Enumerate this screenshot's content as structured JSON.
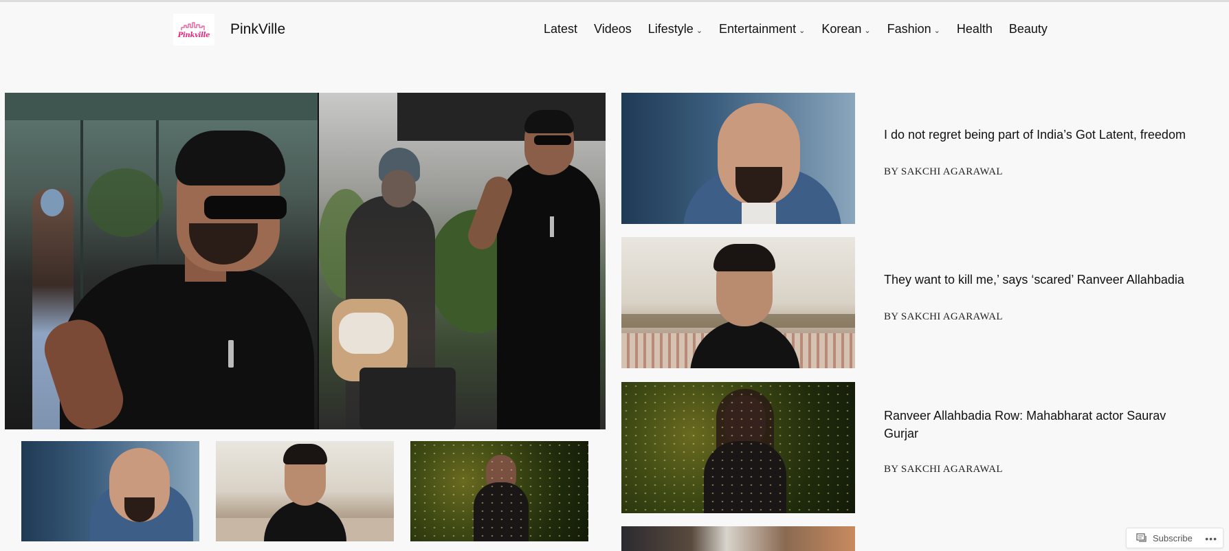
{
  "site": {
    "logo_text": "Pinkville",
    "title": "PinkVille"
  },
  "nav": {
    "items": [
      {
        "label": "Latest",
        "has_dropdown": false
      },
      {
        "label": "Videos",
        "has_dropdown": false
      },
      {
        "label": "Lifestyle",
        "has_dropdown": true
      },
      {
        "label": "Entertainment",
        "has_dropdown": true
      },
      {
        "label": "Korean",
        "has_dropdown": true
      },
      {
        "label": "Fashion",
        "has_dropdown": true
      },
      {
        "label": "Health",
        "has_dropdown": false
      },
      {
        "label": "Beauty",
        "has_dropdown": false
      }
    ],
    "dropdown_glyph": "⌄"
  },
  "articles": [
    {
      "title": "I do not regret being part of India’s Got Latent, freedom",
      "byline": "BY SAKCHI AGARAWAL"
    },
    {
      "title": "They want to kill me,’ says ‘scared’ Ranveer Allahbadia",
      "byline": "BY SAKCHI AGARAWAL"
    },
    {
      "title": "Ranveer Allahbadia Row: Mahabharat actor Saurav Gurjar",
      "byline": "BY SAKCHI AGARAWAL"
    }
  ],
  "subscribe": {
    "label": "Subscribe",
    "more": "•••"
  },
  "colors": {
    "background": "#f8f8f8",
    "brand_pink": "#e3267a",
    "text": "#111111"
  }
}
